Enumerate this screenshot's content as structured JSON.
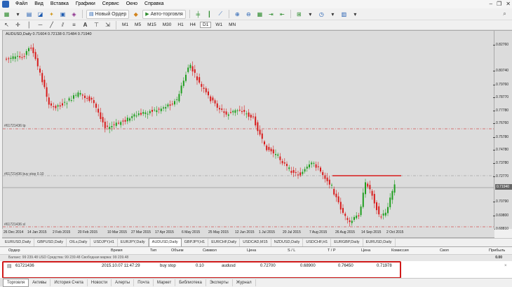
{
  "menu": [
    "Файл",
    "Вид",
    "Вставка",
    "Графики",
    "Сервис",
    "Окно",
    "Справка"
  ],
  "toolbar": {
    "new_order_label": "Новый Ордер",
    "autotrading_label": "Авто-торговля",
    "timeframes": [
      "M1",
      "M5",
      "M15",
      "M30",
      "H1",
      "H4",
      "D1",
      "W1",
      "MN"
    ]
  },
  "chart": {
    "info": "AUDUSD,Daily  0.71604 0.72138 0.71484 0.71940",
    "price_levels": [
      "0.82760",
      "0.80740",
      "0.79760",
      "0.78770",
      "0.77780",
      "0.76760",
      "0.75780",
      "0.74780",
      "0.73780",
      "0.72770",
      "0.71940",
      "0.70790",
      "0.69800",
      "0.68810"
    ],
    "current_price": "0.71940",
    "time_labels": [
      "26 Dec 2014",
      "14 Jan 2015",
      "2 Feb 2015",
      "20 Feb 2015",
      "10 Mar 2015",
      "27 Mar 2015",
      "17 Apr 2015",
      "6 May 2015",
      "25 May 2015",
      "12 Jun 2015",
      "1 Jul 2015",
      "20 Jul 2015",
      "7 Aug 2015",
      "26 Aug 2015",
      "14 Sep 2015",
      "2 Oct 2015"
    ],
    "order_labels": {
      "tp": "#61721436 tp",
      "buy_stop": "#61721436 buy stop 0.10",
      "sl": "#61721436 sl"
    }
  },
  "chart_tabs": [
    "EURUSD,Daily",
    "GBPUSD,Daily",
    "OILs,Daily",
    "USDJPY,H1",
    "EURJPY,Daily",
    "AUDUSD,Daily",
    "GBPJPY,H1",
    "EURCHF,Daily",
    "USDCAD,M15",
    "NZDUSD,Daily",
    "USDCHF,H1",
    "EURGBP,Daily",
    "EURUSD,Daily"
  ],
  "active_chart_tab": "AUDUSD,Daily",
  "terminal": {
    "columns": [
      "Ордер",
      "Время",
      "Тип",
      "Объем",
      "Символ",
      "Цена",
      "S / L",
      "T / P",
      "Цена",
      "Комиссия",
      "Своп",
      "Прибыль"
    ],
    "balance_text": "Баланс: 99 239.48 USD  Средства: 99 239.48  Свободная маржа: 99 239.48",
    "balance_value": "0.00",
    "order": {
      "ticket": "61721436",
      "time": "2015.10.07 11:47:29",
      "type": "buy stop",
      "volume": "0.10",
      "symbol": "audusd",
      "price": "0.72700",
      "sl": "0.68900",
      "tp": "0.76450",
      "current_price": "0.71978"
    },
    "tabs": [
      "Торговля",
      "Активы",
      "История Счета",
      "Новости",
      "Алерты",
      "Почта",
      "Маркет",
      "Библиотека",
      "Эксперты",
      "Журнал"
    ]
  },
  "colors": {
    "bull_candle": "#1f9e1f",
    "bear_candle": "#d81b1b",
    "order_line": "#d81b1b",
    "chart_bg": "#dcdcdc"
  }
}
